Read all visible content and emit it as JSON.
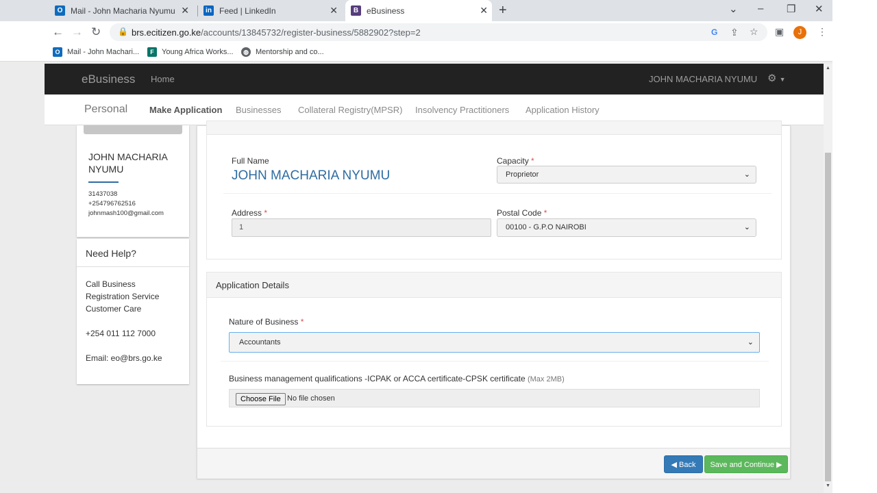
{
  "browser": {
    "tabs": [
      {
        "title": "Mail - John Macharia Nyumu - O",
        "icon": "outlook-icon"
      },
      {
        "title": "Feed | LinkedIn",
        "icon": "linkedin-icon"
      },
      {
        "title": "eBusiness",
        "icon": "bootstrap-icon"
      }
    ],
    "url_host": "brs.ecitizen.go.ke",
    "url_path": "/accounts/13845732/register-business/5882902?step=2",
    "profile_initial": "J",
    "bookmarks": [
      {
        "label": "Mail - John Machari...",
        "icon": "outlook-icon"
      },
      {
        "label": "Young Africa Works...",
        "icon": "forms-icon"
      },
      {
        "label": "Mentorship and co...",
        "icon": "globe-icon"
      }
    ]
  },
  "topnav": {
    "brand": "eBusiness",
    "home": "Home",
    "user": "JOHN MACHARIA NYUMU"
  },
  "subnav": {
    "personal": "Personal",
    "items": [
      "Make Application",
      "Businesses",
      "Collateral Registry(MPSR)",
      "Insolvency Practitioners",
      "Application History"
    ]
  },
  "profile": {
    "name": "JOHN MACHARIA NYUMU",
    "id_number": "31437038",
    "phone": "+254796762516",
    "email": "johnmash100@gmail.com"
  },
  "help": {
    "title": "Need Help?",
    "line1": "Call Business",
    "line2": "Registration Service",
    "line3": "Customer Care",
    "phone": "+254 011 112 7000",
    "email": "Email: eo@brs.go.ke"
  },
  "applicant": {
    "full_name_label": "Full Name",
    "full_name": "JOHN MACHARIA NYUMU",
    "capacity_label": "Capacity",
    "capacity_value": "Proprietor",
    "address_label": "Address",
    "address_value": "1",
    "postal_label": "Postal Code",
    "postal_value": "00100 - G.P.O NAIROBI",
    "required_mark": "*"
  },
  "application": {
    "header": "Application Details",
    "nature_label": "Nature of Business",
    "nature_value": "Accountants",
    "qual_label": "Business management qualifications -ICPAK or ACCA certificate-CPSK certificate",
    "qual_hint": "(Max 2MB)",
    "choose_file": "Choose File",
    "no_file": "No file chosen"
  },
  "footer": {
    "back": "Back",
    "save": "Save and Continue"
  },
  "colors": {
    "accent": "#2d6ca2",
    "navbar": "#222222",
    "back_button": "#337ab7",
    "save_button": "#5cb85c"
  }
}
